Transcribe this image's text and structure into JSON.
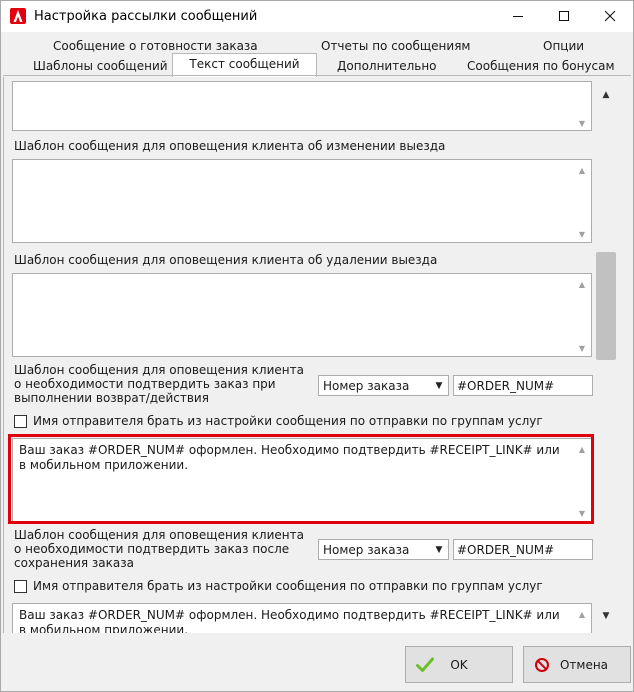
{
  "window": {
    "title": "Настройка рассылки сообщений"
  },
  "tabs": {
    "row1": [
      "Сообщение о готовности заказа",
      "Отчеты по сообщениям",
      "Опции"
    ],
    "row2": [
      "Шаблоны сообщений",
      "Текст сообщений",
      "Дополнительно",
      "Сообщения по бонусам"
    ],
    "active": "Текст сообщений"
  },
  "content": {
    "label_change": "Шаблон сообщения для оповещения клиента об изменении выезда",
    "label_delete": "Шаблон сообщения для оповещения клиента об удалении выезда",
    "label_confirm_action": "Шаблон сообщения для оповещения клиента о необходимости подтвердить заказ при выполнении возврат/действия",
    "combo1_value": "Номер заказа",
    "field1_value": "#ORDER_NUM#",
    "checkbox1_label": "Имя отправителя брать из настройки сообщения по отправки по группам услуг",
    "memo_highlighted_text": "Ваш заказ #ORDER_NUM# оформлен. Необходимо подтвердить #RECEIPT_LINK# или в мобильном приложении.",
    "label_confirm_save": "Шаблон сообщения для оповещения клиента о необходимости подтвердить заказ после сохранения заказа",
    "combo2_value": "Номер заказа",
    "field2_value": "#ORDER_NUM#",
    "checkbox2_label": "Имя отправителя брать из настройки сообщения по отправки по группам услуг",
    "memo_bottom_text": "Ваш заказ #ORDER_NUM# оформлен. Необходимо подтвердить #RECEIPT_LINK# или в мобильном приложении."
  },
  "buttons": {
    "ok": "OK",
    "cancel": "Отмена"
  },
  "colors": {
    "highlight": "#e0000c",
    "ok_check": "#6bbf2a",
    "cancel_icon": "#d0000b",
    "app_icon": "#e3000f"
  }
}
